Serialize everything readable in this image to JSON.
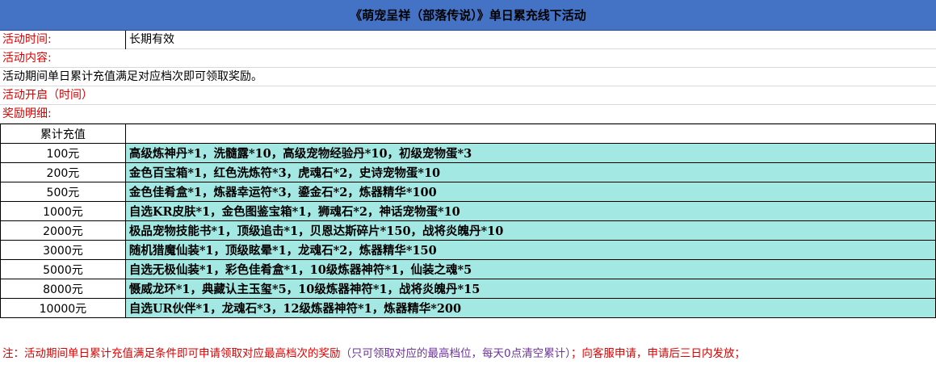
{
  "title": "《萌宠呈祥（部落传说）》单日累充线下活动",
  "info": {
    "time_label": "活动时间:",
    "time_value": "长期有效",
    "content_label": "活动内容:",
    "content_text": "活动期间单日累计充值满足对应档次即可领取奖励。",
    "open_label": "活动开启（时间）",
    "detail_label": "奖励明细:"
  },
  "table": {
    "header_amount": "累计充值",
    "header_reward": "",
    "rows": [
      {
        "amount": "100元",
        "reward": "高级炼神丹*1，洗髓露*10，高级宠物经验丹*10，初级宠物蛋*3"
      },
      {
        "amount": "200元",
        "reward": "金色百宝箱*1，红色洗炼符*3，虎魂石*2，史诗宠物蛋*10"
      },
      {
        "amount": "500元",
        "reward": "金色佳肴盒*1，炼器幸运符*3，鎏金石*2，炼器精华*100"
      },
      {
        "amount": "1000元",
        "reward": "自选KR皮肤*1，金色图鉴宝箱*1，狮魂石*2，神话宠物蛋*10"
      },
      {
        "amount": "2000元",
        "reward": "极品宠物技能书*1，顶级追击*1，贝恩达斯碎片*150，战将炎魄丹*10"
      },
      {
        "amount": "3000元",
        "reward": "随机猎魔仙装*1，顶级眩晕*1，龙魂石*2，炼器精华*150"
      },
      {
        "amount": "5000元",
        "reward": "自选无极仙装*1，彩色佳肴盒*1，10级炼器神符*1，仙装之魂*5"
      },
      {
        "amount": "8000元",
        "reward": "慑威龙环*1，典藏认主玉玺*5，10级炼器神符*1，战将炎魄丹*15"
      },
      {
        "amount": "10000元",
        "reward": "自选UR伙伴*1，龙魂石*3，12级炼器神符*1，炼器精华*200"
      }
    ]
  },
  "note": {
    "part1": "注：活动期间单日累计充值满足条件即可申请领取对应最高档次的奖励",
    "part2": "（只可领取对应的最高档位，每天0点清空累计）",
    "part3": "；向客服申请，申请后三日内发放；"
  },
  "colors": {
    "title_bg": "#4472C4",
    "reward_bg": "#A4E8E3",
    "label_red": "#E00000",
    "note_purple": "#7030A0"
  }
}
